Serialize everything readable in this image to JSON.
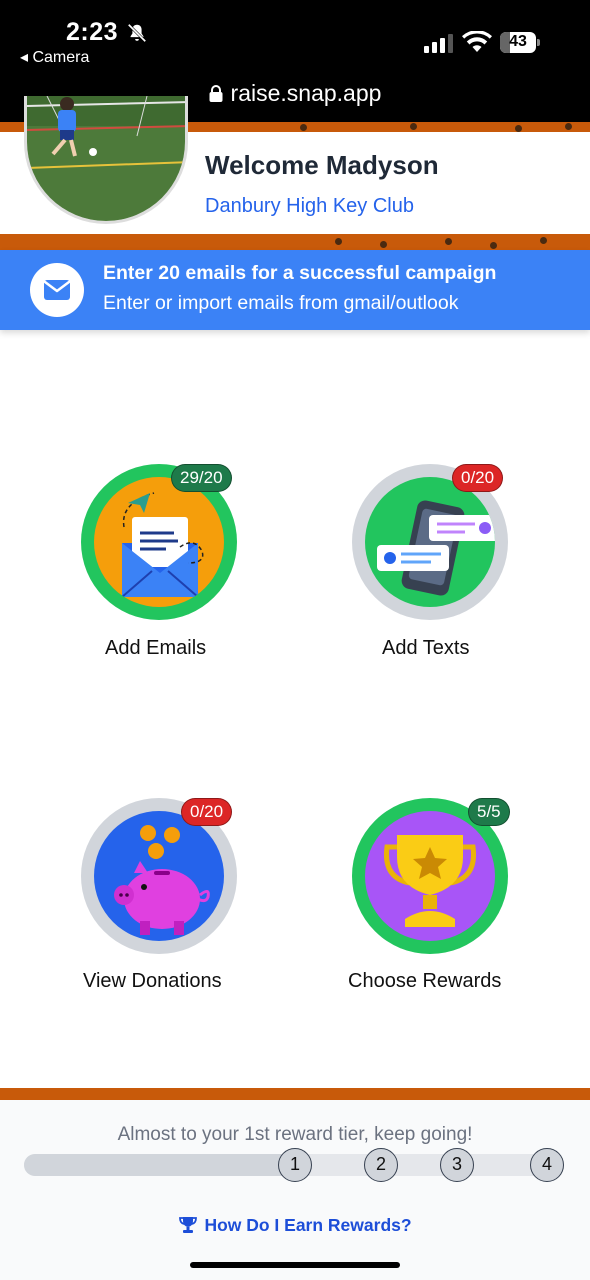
{
  "status_bar": {
    "time": "2:23",
    "back_label": "◂ Camera",
    "battery": "43",
    "url": "raise.snap.app"
  },
  "header": {
    "welcome": "Welcome Madyson",
    "club": "Danbury High Key Club"
  },
  "banner": {
    "title": "Enter 20 emails for a successful campaign",
    "subtitle": "Enter or import emails from gmail/outlook"
  },
  "tiles": [
    {
      "label": "Add Emails",
      "badge": "29/20",
      "badge_color": "#1e7a4a",
      "ring_color": "#22c55e",
      "fill_color": "#f59e0b"
    },
    {
      "label": "Add Texts",
      "badge": "0/20",
      "badge_color": "#dc2626",
      "ring_color": "#d1d5db",
      "fill_color": "#22c55e"
    },
    {
      "label": "View Donations",
      "badge": "0/20",
      "badge_color": "#dc2626",
      "ring_color": "#d1d5db",
      "fill_color": "#2563eb"
    },
    {
      "label": "Choose Rewards",
      "badge": "5/5",
      "badge_color": "#1e7a4a",
      "ring_color": "#22c55e",
      "fill_color": "#a855f7"
    }
  ],
  "footer": {
    "progress_text": "Almost to your 1st reward tier, keep going!",
    "progress_fraction": 0.5,
    "tiers": [
      "1",
      "2",
      "3",
      "4"
    ],
    "rewards_link": "How Do I Earn Rewards?"
  },
  "colors": {
    "brand_orange": "#c85a0a",
    "banner_blue": "#3b82f6",
    "link_blue": "#2563eb"
  }
}
